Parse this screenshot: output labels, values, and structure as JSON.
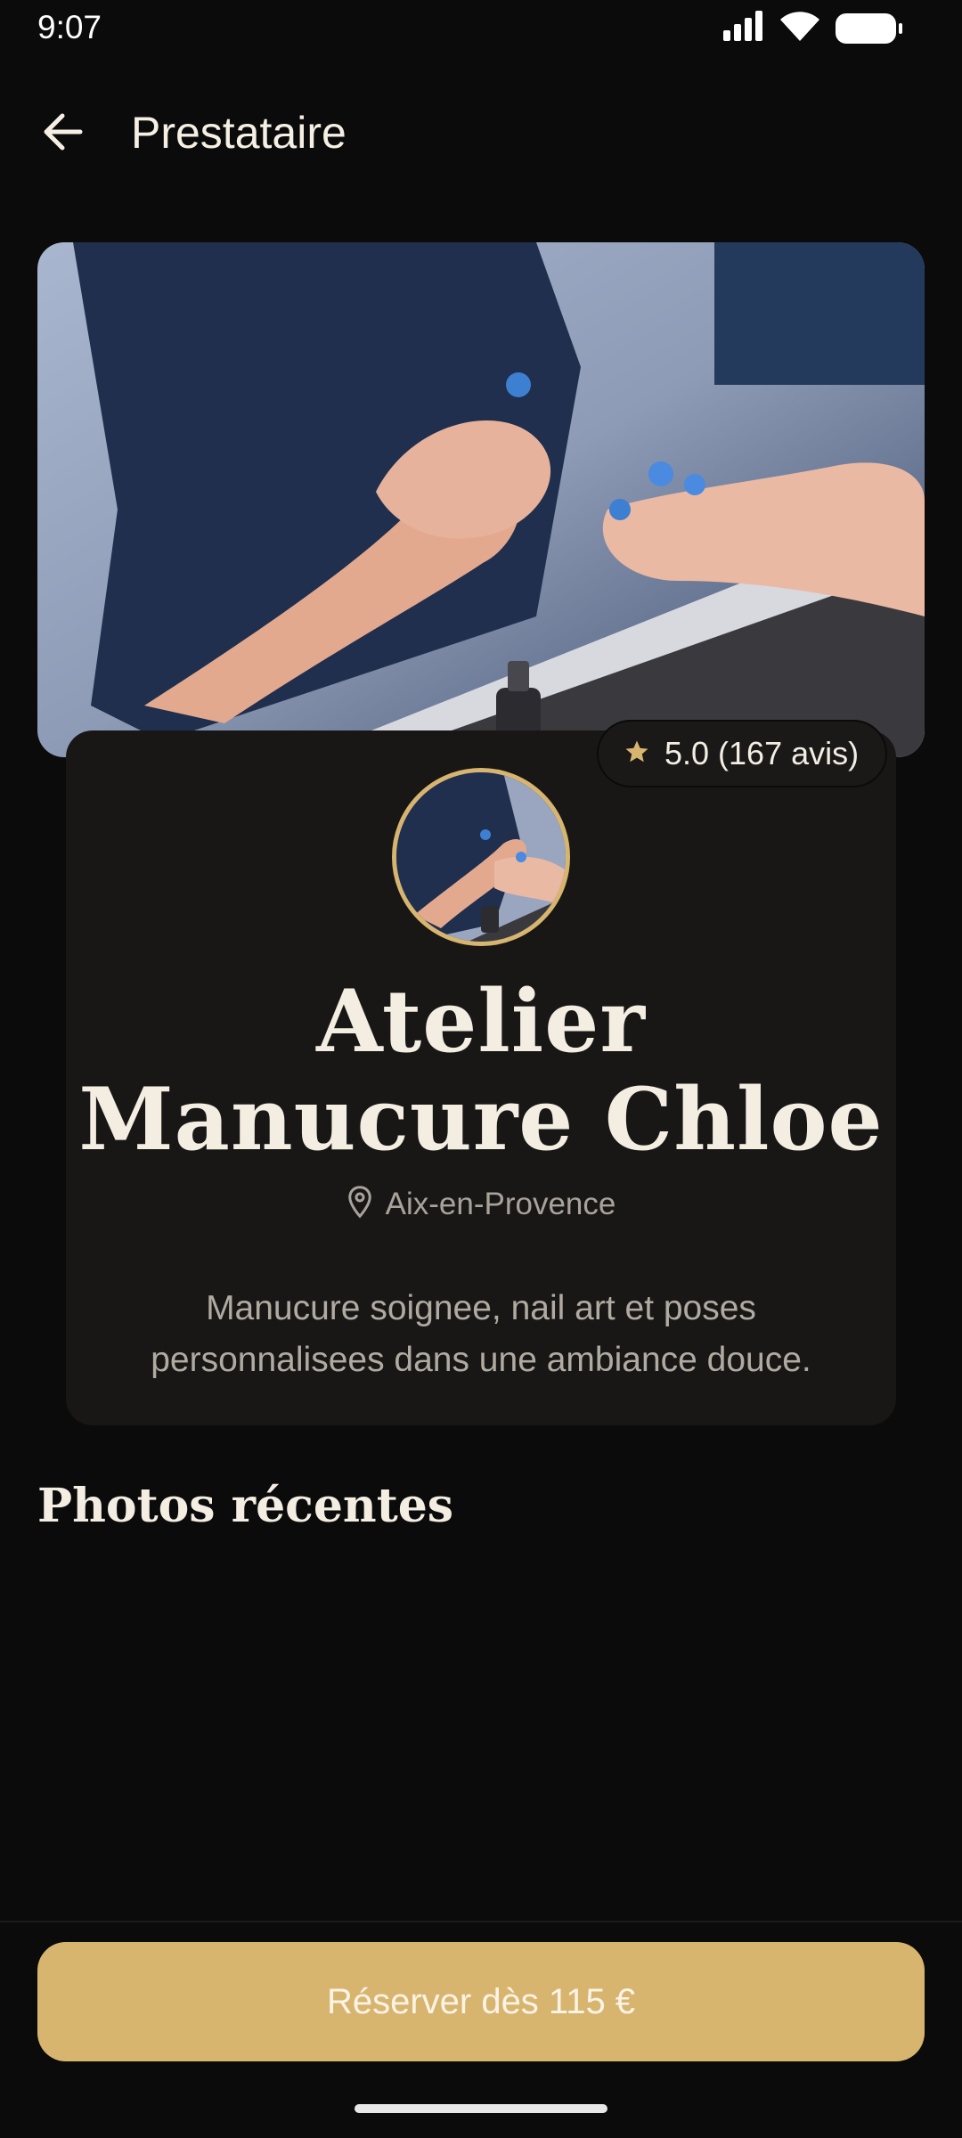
{
  "status_bar": {
    "time": "9:07",
    "icons": [
      "signal-icon",
      "wifi-icon",
      "battery-icon"
    ]
  },
  "app_bar": {
    "back_icon": "arrow-left-icon",
    "title": "Prestataire"
  },
  "hero": {
    "image": "manicure-photo"
  },
  "profile": {
    "rating_icon": "star-icon",
    "rating": "5.0 (167 avis)",
    "name_line1": "Atelier",
    "name_line2": "Manucure Chloe",
    "location_icon": "location-pin-icon",
    "location": "Aix-en-Provence",
    "description": "Manucure soignee, nail art et poses personnalisees dans une ambiance douce."
  },
  "photos_section": {
    "title": "Photos récentes"
  },
  "booking": {
    "button_label": "Réserver dès 115 €"
  },
  "colors": {
    "background": "#0b0b0b",
    "card": "#181716",
    "accent_gold": "#d8b56f",
    "text_primary": "#f3ede2",
    "text_secondary": "#a8a29a"
  }
}
